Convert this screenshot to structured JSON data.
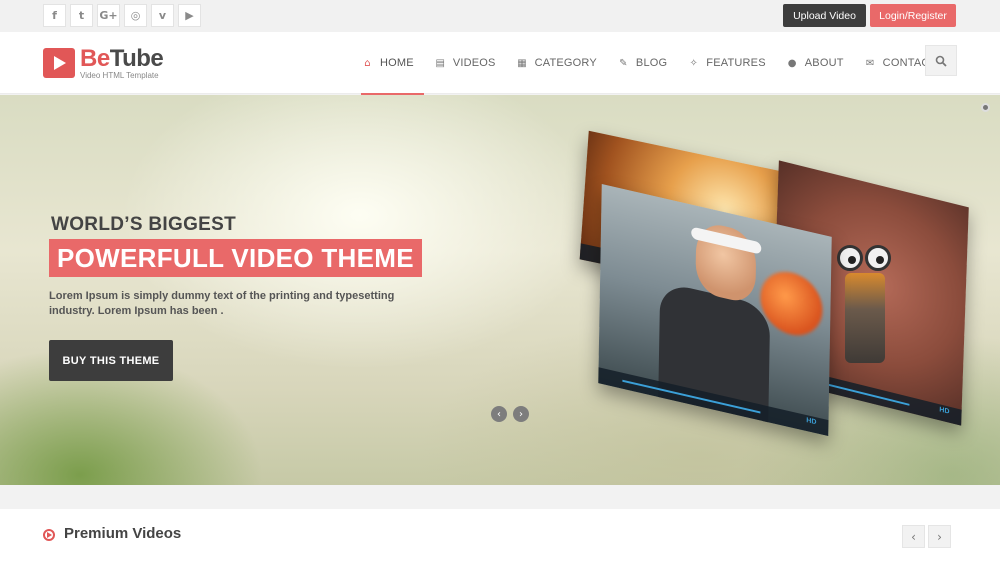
{
  "topbar": {
    "social": [
      {
        "name": "facebook-icon",
        "glyph": "f"
      },
      {
        "name": "twitter-icon",
        "glyph": "t"
      },
      {
        "name": "google-plus-icon",
        "glyph": "G+"
      },
      {
        "name": "instagram-icon",
        "glyph": "◎"
      },
      {
        "name": "vimeo-icon",
        "glyph": "v"
      },
      {
        "name": "youtube-icon",
        "glyph": "▶"
      }
    ],
    "upload_label": "Upload Video",
    "login_label": "Login/Register"
  },
  "header": {
    "logo_name_part1": "Be",
    "logo_name_part2": "Tube",
    "logo_tagline": "Video HTML Template",
    "nav": [
      {
        "label": "HOME",
        "icon": "home-icon",
        "glyph": "⌂",
        "active": true
      },
      {
        "label": "VIDEOS",
        "icon": "film-icon",
        "glyph": "▤",
        "active": false
      },
      {
        "label": "CATEGORY",
        "icon": "grid-icon",
        "glyph": "▦",
        "active": false
      },
      {
        "label": "BLOG",
        "icon": "edit-icon",
        "glyph": "✎",
        "active": false
      },
      {
        "label": "FEATURES",
        "icon": "magic-wand-icon",
        "glyph": "✧",
        "active": false
      },
      {
        "label": "ABOUT",
        "icon": "user-icon",
        "glyph": "●",
        "active": false
      },
      {
        "label": "CONTACT",
        "icon": "envelope-icon",
        "glyph": "✉",
        "active": false
      }
    ]
  },
  "hero": {
    "subtitle": "WORLD’S BIGGEST",
    "title": "POWERFULL VIDEO THEME",
    "description": "Lorem Ipsum is simply dummy text of the printing and typesetting industry. Lorem Ipsum has been .",
    "button_label": "BUY THIS THEME"
  },
  "premium": {
    "title": "Premium Videos"
  },
  "colors": {
    "accent": "#e96969",
    "dark": "#3d3d3d"
  }
}
